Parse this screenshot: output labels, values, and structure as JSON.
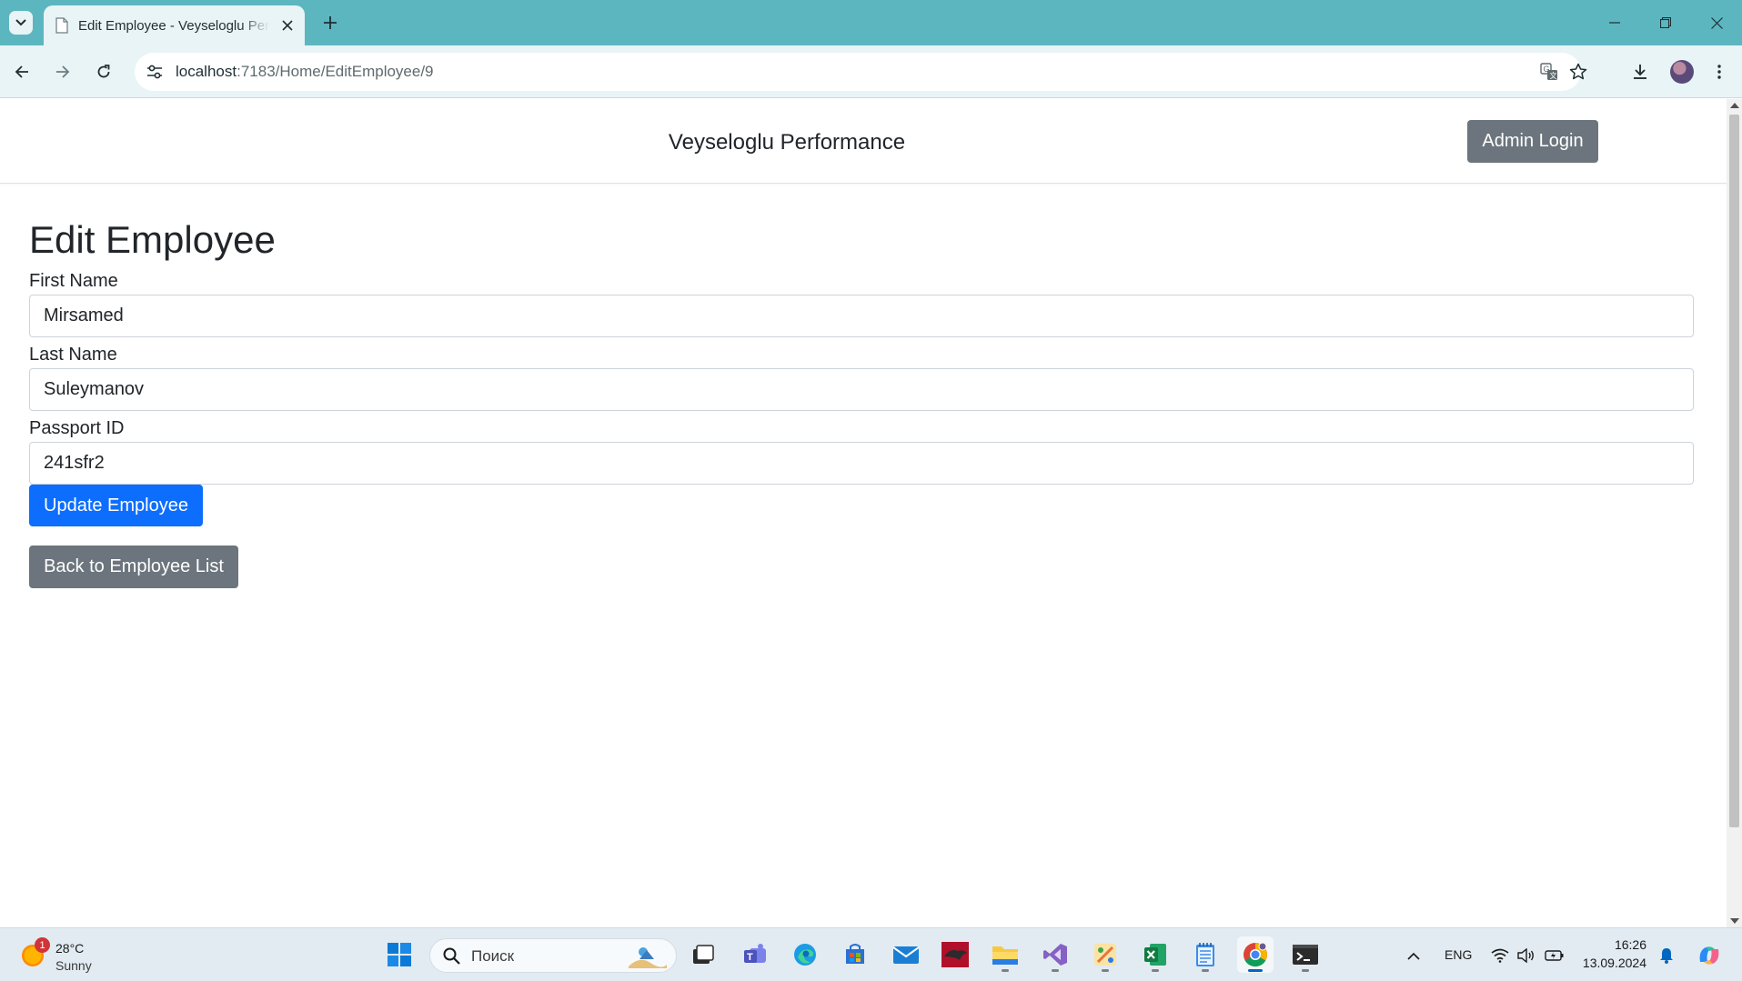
{
  "browser": {
    "tab_title": "Edit Employee - Veyseloglu Performance",
    "url_host": "localhost",
    "url_path": ":7183/Home/EditEmployee/9"
  },
  "page": {
    "brand": "Veyseloglu Performance",
    "admin_login_label": "Admin Login",
    "title": "Edit Employee",
    "form": {
      "first_name_label": "First Name",
      "first_name_value": "Mirsamed",
      "last_name_label": "Last Name",
      "last_name_value": "Suleymanov",
      "passport_label": "Passport ID",
      "passport_value": "241sfr2",
      "submit_label": "Update Employee"
    },
    "back_label": "Back to Employee List",
    "colors": {
      "primary": "#0d6efd",
      "secondary": "#6c757d",
      "browser_frame": "#5cb6c0"
    }
  },
  "taskbar": {
    "weather_temp": "28°C",
    "weather_desc": "Sunny",
    "weather_badge": "1",
    "search_placeholder": "Поиск",
    "language": "ENG",
    "time": "16:26",
    "date": "13.09.2024",
    "apps": [
      "start-icon",
      "task-view-icon",
      "teams-icon",
      "edge-icon",
      "store-icon",
      "mail-icon",
      "sql-server-icon",
      "file-explorer-icon",
      "visual-studio-icon",
      "paint-icon",
      "excel-icon",
      "notepad-icon",
      "chrome-icon",
      "terminal-icon"
    ]
  }
}
